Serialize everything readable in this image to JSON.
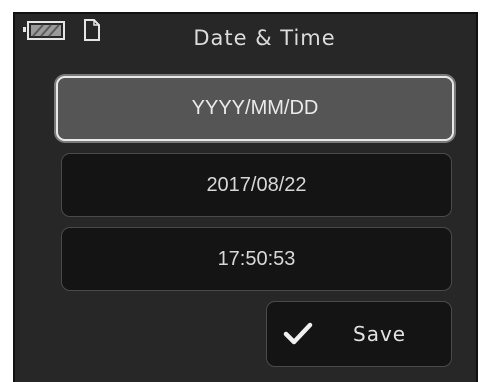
{
  "header": {
    "title": "Date & Time",
    "battery_icon": "battery-icon",
    "file_icon": "file-icon"
  },
  "fields": {
    "format": "YYYY/MM/DD",
    "date": "2017/08/22",
    "time": "17:50:53"
  },
  "actions": {
    "save_label": "Save",
    "save_icon": "check-icon"
  },
  "colors": {
    "background": "#272727",
    "button": "#141414",
    "selected": "#555555",
    "text": "#dcdcdc"
  }
}
